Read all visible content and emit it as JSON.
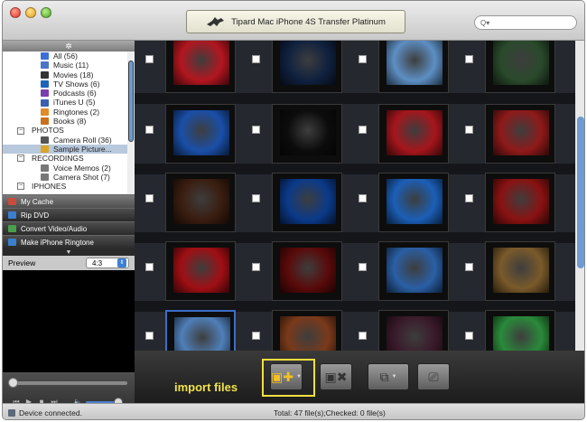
{
  "window": {
    "title": "Tipard Mac iPhone 4S Transfer Platinum"
  },
  "search": {
    "placeholder": "Q▾"
  },
  "tree_header_icon": "gear-icon",
  "tree": [
    {
      "label": "All (56)",
      "kind": "child",
      "icon": "all-icon",
      "color": "#3b6fd6"
    },
    {
      "label": "Music (11)",
      "kind": "child",
      "icon": "music-icon",
      "color": "#4b74c8"
    },
    {
      "label": "Movies (18)",
      "kind": "child",
      "icon": "movies-icon",
      "color": "#333333"
    },
    {
      "label": "TV Shows (6)",
      "kind": "child",
      "icon": "tv-icon",
      "color": "#1f63b8"
    },
    {
      "label": "Podcasts (6)",
      "kind": "child",
      "icon": "podcast-icon",
      "color": "#7b3fb0"
    },
    {
      "label": "iTunes U (5)",
      "kind": "child",
      "icon": "itunes-u-icon",
      "color": "#3a5fb0"
    },
    {
      "label": "Ringtones (2)",
      "kind": "child",
      "icon": "ringtone-icon",
      "color": "#e08a2a"
    },
    {
      "label": "Books (8)",
      "kind": "child",
      "icon": "books-icon",
      "color": "#c9701e"
    },
    {
      "label": "PHOTOS",
      "kind": "group",
      "icon": "",
      "color": ""
    },
    {
      "label": "Camera Roll (36)",
      "kind": "child",
      "icon": "camera-roll-icon",
      "color": "#555555"
    },
    {
      "label": "Sample Picture...",
      "kind": "child",
      "icon": "album-icon",
      "color": "#d9a62a",
      "selected": true
    },
    {
      "label": "RECORDINGS",
      "kind": "group",
      "icon": "",
      "color": ""
    },
    {
      "label": "Voice Memos (2)",
      "kind": "child",
      "icon": "voice-memo-icon",
      "color": "#777777"
    },
    {
      "label": "Camera Shot (7)",
      "kind": "child",
      "icon": "camera-shot-icon",
      "color": "#777777"
    },
    {
      "label": "IPHONES",
      "kind": "group",
      "icon": "",
      "color": ""
    }
  ],
  "sidebar_buttons": [
    {
      "label": "My Cache",
      "icon": "cache-icon",
      "color": "#c94b3b"
    },
    {
      "label": "Rip DVD",
      "icon": "dvd-icon",
      "color": "#3a7fd0"
    },
    {
      "label": "Convert Video/Audio",
      "icon": "convert-icon",
      "color": "#4aa04a"
    },
    {
      "label": "Make iPhone Ringtone",
      "icon": "ringtone-maker-icon",
      "color": "#3a7fd0"
    }
  ],
  "preview": {
    "label": "Preview",
    "ratio": "4:3"
  },
  "toolbar": {
    "import_label": "import files",
    "buttons": [
      {
        "name": "import-button",
        "icon": "import-icon",
        "glyph": "▣✚"
      },
      {
        "name": "delete-button",
        "icon": "delete-icon",
        "glyph": "▣✖"
      },
      {
        "name": "export-to-mac-button",
        "icon": "export-icon",
        "glyph": "⧉"
      },
      {
        "name": "transfer-button",
        "icon": "transfer-icon",
        "glyph": "🖥"
      }
    ]
  },
  "status": {
    "device": "Device connected.",
    "totals": "Total: 47 file(s);Checked: 0 file(s)"
  },
  "thumbnails": [
    [
      "#b3161f",
      "#10213f",
      "#5d8fc4",
      "#2a4a2c"
    ],
    [
      "#1a4fa8",
      "#0c0c0c",
      "#a5161c",
      "#8f1a1a"
    ],
    [
      "#3a1d10",
      "#0b3a8a",
      "#1b5fb7",
      "#8a1212"
    ],
    [
      "#a00f14",
      "#5a0a0a",
      "#2a5fa5",
      "#7a5a2a"
    ],
    [
      "#4f7fb8",
      "#7a3a1a",
      "#3a1a2a",
      "#2a8a3a"
    ]
  ],
  "colors": {
    "accent": "#3b6fc6",
    "highlight": "#f2df3d"
  }
}
